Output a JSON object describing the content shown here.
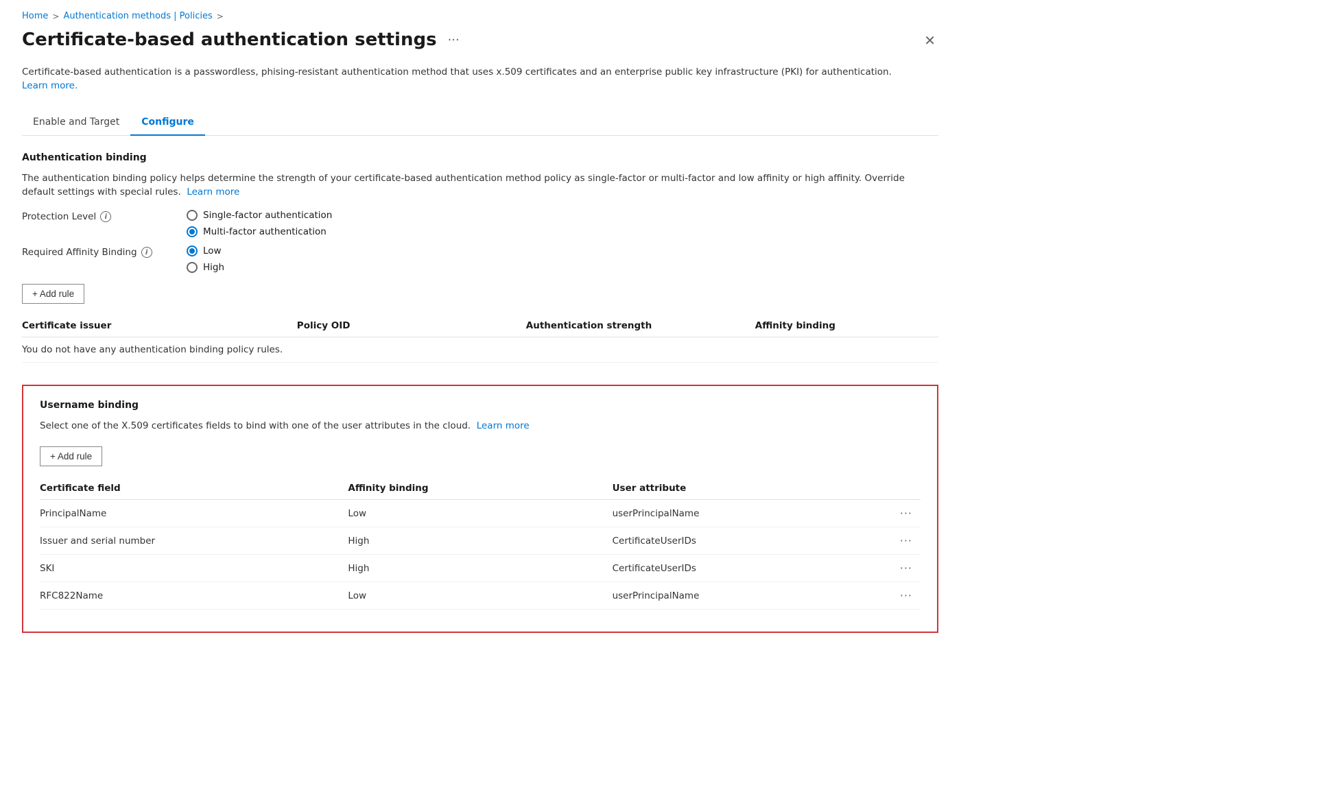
{
  "breadcrumb": {
    "items": [
      {
        "label": "Home",
        "active": false
      },
      {
        "label": "Authentication methods | Policies",
        "active": true
      }
    ],
    "separators": [
      ">",
      ">"
    ]
  },
  "page": {
    "title": "Certificate-based authentication settings",
    "more_options_icon": "···",
    "close_icon": "✕",
    "description": "Certificate-based authentication is a passwordless, phising-resistant authentication method that uses x.509 certificates and an enterprise public key infrastructure (PKI) for authentication.",
    "description_link": "Learn more."
  },
  "tabs": [
    {
      "label": "Enable and Target",
      "active": false
    },
    {
      "label": "Configure",
      "active": true
    }
  ],
  "auth_binding": {
    "section_title": "Authentication binding",
    "description": "The authentication binding policy helps determine the strength of your certificate-based authentication method policy as single-factor or multi-factor and low affinity or high affinity. Override default settings with special rules.",
    "description_link": "Learn more",
    "protection_level": {
      "label": "Protection Level",
      "options": [
        {
          "label": "Single-factor authentication",
          "selected": false
        },
        {
          "label": "Multi-factor authentication",
          "selected": true
        }
      ]
    },
    "required_affinity_binding": {
      "label": "Required Affinity Binding",
      "options": [
        {
          "label": "Low",
          "selected": true
        },
        {
          "label": "High",
          "selected": false
        }
      ]
    },
    "add_rule_btn": "+ Add rule",
    "table": {
      "columns": [
        {
          "label": "Certificate issuer"
        },
        {
          "label": "Policy OID"
        },
        {
          "label": "Authentication strength"
        },
        {
          "label": "Affinity binding"
        }
      ],
      "empty_message": "You do not have any authentication binding policy rules."
    }
  },
  "username_binding": {
    "section_title": "Username binding",
    "description": "Select one of the X.509 certificates fields to bind with one of the user attributes in the cloud.",
    "description_link": "Learn more",
    "add_rule_btn": "+ Add rule",
    "table": {
      "columns": [
        {
          "label": "Certificate field"
        },
        {
          "label": "Affinity binding"
        },
        {
          "label": "User attribute"
        },
        {
          "label": ""
        }
      ],
      "rows": [
        {
          "cert_field": "PrincipalName",
          "affinity_binding": "Low",
          "user_attribute": "userPrincipalName"
        },
        {
          "cert_field": "Issuer and serial number",
          "affinity_binding": "High",
          "user_attribute": "CertificateUserIDs"
        },
        {
          "cert_field": "SKI",
          "affinity_binding": "High",
          "user_attribute": "CertificateUserIDs"
        },
        {
          "cert_field": "RFC822Name",
          "affinity_binding": "Low",
          "user_attribute": "userPrincipalName"
        }
      ]
    }
  },
  "icons": {
    "info": "i",
    "add": "+",
    "more": "···",
    "close": "✕",
    "radio_dot": "●"
  }
}
